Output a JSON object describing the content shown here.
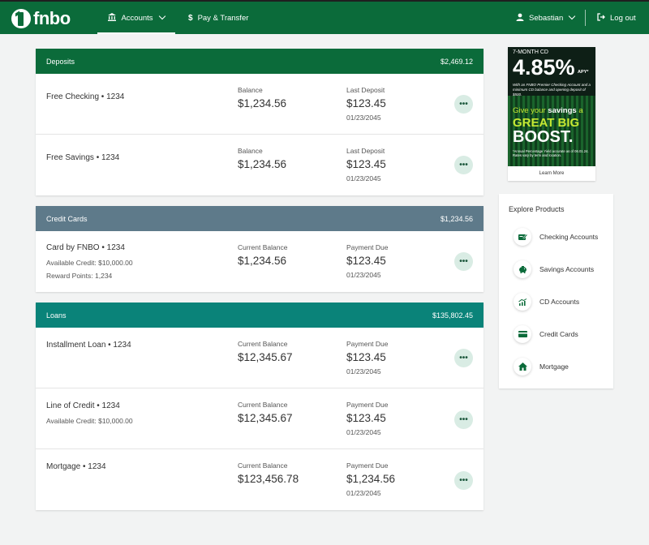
{
  "header": {
    "logo_text": "fnbo",
    "nav": [
      {
        "label": "Accounts",
        "icon": "bank-icon"
      },
      {
        "label": "Pay & Transfer",
        "icon": "dollar-icon"
      }
    ],
    "user": {
      "label": "Sebastian",
      "icon": "user-icon"
    },
    "logout": {
      "label": "Log out",
      "icon": "logout-icon"
    }
  },
  "sections": {
    "deposits": {
      "title": "Deposits",
      "total": "$2,469.12",
      "color": "#0b6b3a",
      "accounts": [
        {
          "name": "Free Checking • 1234",
          "label1": "Balance",
          "value1": "$1,234.56",
          "label2": "Last Deposit",
          "value2": "$123.45",
          "date": "01/23/2045"
        },
        {
          "name": "Free Savings • 1234",
          "label1": "Balance",
          "value1": "$1,234.56",
          "label2": "Last Deposit",
          "value2": "$123.45",
          "date": "01/23/2045"
        }
      ]
    },
    "credit": {
      "title": "Credit Cards",
      "total": "$1,234.56",
      "color": "#5e7a8a",
      "accounts": [
        {
          "name": "Card by FNBO • 1234",
          "sub1": "Available Credit: $10,000.00",
          "sub2": "Reward Points: 1,234",
          "label1": "Current Balance",
          "value1": "$1,234.56",
          "label2": "Payment Due",
          "value2": "$123.45",
          "date": "01/23/2045"
        }
      ]
    },
    "loans": {
      "title": "Loans",
      "total": "$135,802.45",
      "color": "#0a8379",
      "accounts": [
        {
          "name": "Installment Loan • 1234",
          "label1": "Current Balance",
          "value1": "$12,345.67",
          "label2": "Payment Due",
          "value2": "$123.45",
          "date": "01/23/2045"
        },
        {
          "name": "Line of Credit • 1234",
          "sub1": "Available Credit: $10,000.00",
          "label1": "Current Balance",
          "value1": "$12,345.67",
          "label2": "Payment Due",
          "value2": "$123.45",
          "date": "01/23/2045"
        },
        {
          "name": "Mortgage • 1234",
          "label1": "Current Balance",
          "value1": "$123,456.78",
          "label2": "Payment Due",
          "value2": "$1,234.56",
          "date": "01/23/2045"
        }
      ]
    }
  },
  "more_label": "•••",
  "ad": {
    "top": "7-MONTH CD",
    "rate": "4.85%",
    "apy": "APY*",
    "small": "With an FNBO Premier Checking Account and a minimum CD balance and opening deposit of $500.",
    "give": "Give your",
    "give_bold": "savings",
    "give_end": "a",
    "great": "GREAT BIG",
    "boost": "BOOST.",
    "fine": "*Annual Percentage Yield accurate as of 06.01.24. Rates vary by term and location.",
    "learn": "Learn More"
  },
  "explore": {
    "title": "Explore Products",
    "items": [
      {
        "label": "Checking Accounts",
        "icon": "checkbook-icon"
      },
      {
        "label": "Savings Accounts",
        "icon": "piggy-bank-icon"
      },
      {
        "label": "CD Accounts",
        "icon": "growth-chart-icon"
      },
      {
        "label": "Credit Cards",
        "icon": "credit-card-icon"
      },
      {
        "label": "Mortgage",
        "icon": "house-icon"
      }
    ]
  }
}
